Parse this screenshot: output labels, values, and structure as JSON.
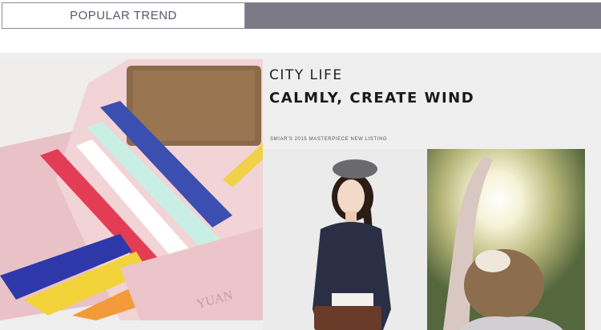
{
  "tab": {
    "title": "POPULAR TREND"
  },
  "banner": {
    "headline1": "CITY LIFE",
    "headline2": "CALMLY, CREATE WIND",
    "subline": "SMIAR'S 2015 MASTERPIECE NEW LISTING",
    "wallet_imprint": "YUAN"
  },
  "colors": {
    "tab_fill": "#7d7a88",
    "wallet_pink": "#f2d3d6"
  }
}
